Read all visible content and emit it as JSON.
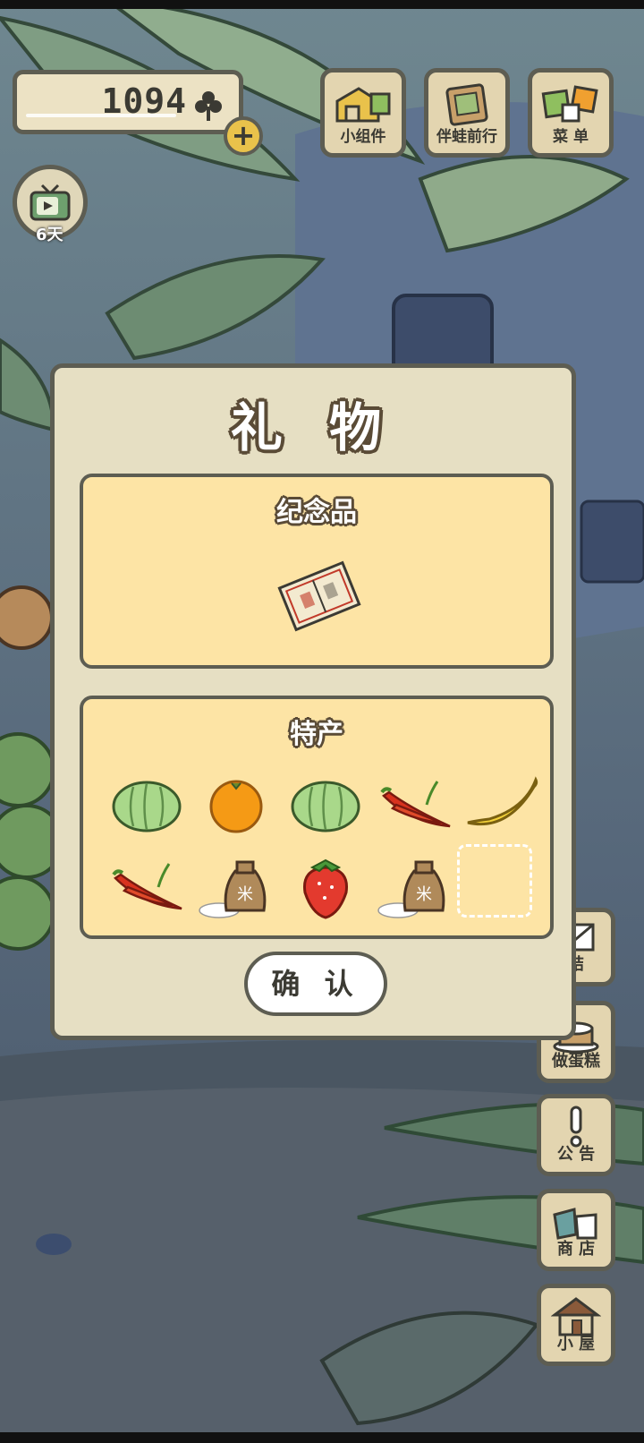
{
  "currency": {
    "clovers": "1094",
    "plus_label": "+"
  },
  "tv": {
    "days": "6天"
  },
  "top_buttons": [
    {
      "label": "小组件",
      "icon": "widget-icon"
    },
    {
      "label": "伴蛙前行",
      "icon": "frog-companion-icon"
    },
    {
      "label": "菜 单",
      "icon": "menu-cards-icon"
    }
  ],
  "side_buttons": [
    {
      "label": "结",
      "icon": "letter-icon"
    },
    {
      "label": "做蛋糕",
      "icon": "cake-icon"
    },
    {
      "label": "公 告",
      "icon": "exclamation-icon"
    },
    {
      "label": "商 店",
      "icon": "shop-bags-icon"
    },
    {
      "label": "小 屋",
      "icon": "house-icon"
    }
  ],
  "dialog": {
    "title": "礼 物",
    "souvenir": {
      "title": "纪念品",
      "items": [
        "book-icon"
      ]
    },
    "specialty": {
      "title": "特产",
      "items": [
        "cabbage-icon",
        "orange-icon",
        "cabbage-icon",
        "chili-pepper-icon",
        "banana-icon",
        "chili-pepper-icon",
        "rice-bag-icon",
        "strawberry-icon",
        "rice-bag-icon",
        "empty-slot"
      ]
    },
    "confirm_label": "确 认"
  }
}
